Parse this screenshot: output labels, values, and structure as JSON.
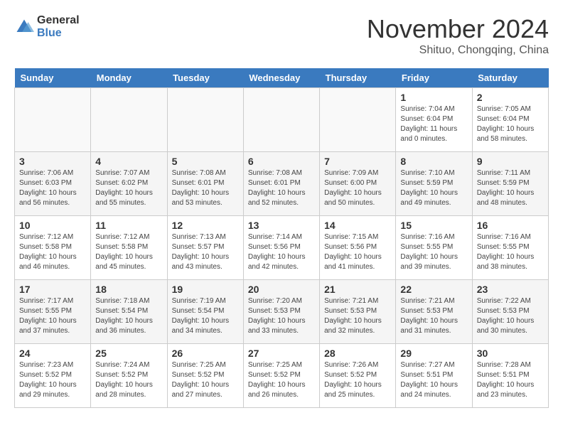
{
  "header": {
    "logo_general": "General",
    "logo_blue": "Blue",
    "month_title": "November 2024",
    "subtitle": "Shituo, Chongqing, China"
  },
  "days_of_week": [
    "Sunday",
    "Monday",
    "Tuesday",
    "Wednesday",
    "Thursday",
    "Friday",
    "Saturday"
  ],
  "weeks": [
    [
      {
        "day": "",
        "empty": true
      },
      {
        "day": "",
        "empty": true
      },
      {
        "day": "",
        "empty": true
      },
      {
        "day": "",
        "empty": true
      },
      {
        "day": "",
        "empty": true
      },
      {
        "day": "1",
        "sunrise": "Sunrise: 7:04 AM",
        "sunset": "Sunset: 6:04 PM",
        "daylight": "Daylight: 11 hours and 0 minutes."
      },
      {
        "day": "2",
        "sunrise": "Sunrise: 7:05 AM",
        "sunset": "Sunset: 6:04 PM",
        "daylight": "Daylight: 10 hours and 58 minutes."
      }
    ],
    [
      {
        "day": "3",
        "sunrise": "Sunrise: 7:06 AM",
        "sunset": "Sunset: 6:03 PM",
        "daylight": "Daylight: 10 hours and 56 minutes."
      },
      {
        "day": "4",
        "sunrise": "Sunrise: 7:07 AM",
        "sunset": "Sunset: 6:02 PM",
        "daylight": "Daylight: 10 hours and 55 minutes."
      },
      {
        "day": "5",
        "sunrise": "Sunrise: 7:08 AM",
        "sunset": "Sunset: 6:01 PM",
        "daylight": "Daylight: 10 hours and 53 minutes."
      },
      {
        "day": "6",
        "sunrise": "Sunrise: 7:08 AM",
        "sunset": "Sunset: 6:01 PM",
        "daylight": "Daylight: 10 hours and 52 minutes."
      },
      {
        "day": "7",
        "sunrise": "Sunrise: 7:09 AM",
        "sunset": "Sunset: 6:00 PM",
        "daylight": "Daylight: 10 hours and 50 minutes."
      },
      {
        "day": "8",
        "sunrise": "Sunrise: 7:10 AM",
        "sunset": "Sunset: 5:59 PM",
        "daylight": "Daylight: 10 hours and 49 minutes."
      },
      {
        "day": "9",
        "sunrise": "Sunrise: 7:11 AM",
        "sunset": "Sunset: 5:59 PM",
        "daylight": "Daylight: 10 hours and 48 minutes."
      }
    ],
    [
      {
        "day": "10",
        "sunrise": "Sunrise: 7:12 AM",
        "sunset": "Sunset: 5:58 PM",
        "daylight": "Daylight: 10 hours and 46 minutes."
      },
      {
        "day": "11",
        "sunrise": "Sunrise: 7:12 AM",
        "sunset": "Sunset: 5:58 PM",
        "daylight": "Daylight: 10 hours and 45 minutes."
      },
      {
        "day": "12",
        "sunrise": "Sunrise: 7:13 AM",
        "sunset": "Sunset: 5:57 PM",
        "daylight": "Daylight: 10 hours and 43 minutes."
      },
      {
        "day": "13",
        "sunrise": "Sunrise: 7:14 AM",
        "sunset": "Sunset: 5:56 PM",
        "daylight": "Daylight: 10 hours and 42 minutes."
      },
      {
        "day": "14",
        "sunrise": "Sunrise: 7:15 AM",
        "sunset": "Sunset: 5:56 PM",
        "daylight": "Daylight: 10 hours and 41 minutes."
      },
      {
        "day": "15",
        "sunrise": "Sunrise: 7:16 AM",
        "sunset": "Sunset: 5:55 PM",
        "daylight": "Daylight: 10 hours and 39 minutes."
      },
      {
        "day": "16",
        "sunrise": "Sunrise: 7:16 AM",
        "sunset": "Sunset: 5:55 PM",
        "daylight": "Daylight: 10 hours and 38 minutes."
      }
    ],
    [
      {
        "day": "17",
        "sunrise": "Sunrise: 7:17 AM",
        "sunset": "Sunset: 5:55 PM",
        "daylight": "Daylight: 10 hours and 37 minutes."
      },
      {
        "day": "18",
        "sunrise": "Sunrise: 7:18 AM",
        "sunset": "Sunset: 5:54 PM",
        "daylight": "Daylight: 10 hours and 36 minutes."
      },
      {
        "day": "19",
        "sunrise": "Sunrise: 7:19 AM",
        "sunset": "Sunset: 5:54 PM",
        "daylight": "Daylight: 10 hours and 34 minutes."
      },
      {
        "day": "20",
        "sunrise": "Sunrise: 7:20 AM",
        "sunset": "Sunset: 5:53 PM",
        "daylight": "Daylight: 10 hours and 33 minutes."
      },
      {
        "day": "21",
        "sunrise": "Sunrise: 7:21 AM",
        "sunset": "Sunset: 5:53 PM",
        "daylight": "Daylight: 10 hours and 32 minutes."
      },
      {
        "day": "22",
        "sunrise": "Sunrise: 7:21 AM",
        "sunset": "Sunset: 5:53 PM",
        "daylight": "Daylight: 10 hours and 31 minutes."
      },
      {
        "day": "23",
        "sunrise": "Sunrise: 7:22 AM",
        "sunset": "Sunset: 5:53 PM",
        "daylight": "Daylight: 10 hours and 30 minutes."
      }
    ],
    [
      {
        "day": "24",
        "sunrise": "Sunrise: 7:23 AM",
        "sunset": "Sunset: 5:52 PM",
        "daylight": "Daylight: 10 hours and 29 minutes."
      },
      {
        "day": "25",
        "sunrise": "Sunrise: 7:24 AM",
        "sunset": "Sunset: 5:52 PM",
        "daylight": "Daylight: 10 hours and 28 minutes."
      },
      {
        "day": "26",
        "sunrise": "Sunrise: 7:25 AM",
        "sunset": "Sunset: 5:52 PM",
        "daylight": "Daylight: 10 hours and 27 minutes."
      },
      {
        "day": "27",
        "sunrise": "Sunrise: 7:25 AM",
        "sunset": "Sunset: 5:52 PM",
        "daylight": "Daylight: 10 hours and 26 minutes."
      },
      {
        "day": "28",
        "sunrise": "Sunrise: 7:26 AM",
        "sunset": "Sunset: 5:52 PM",
        "daylight": "Daylight: 10 hours and 25 minutes."
      },
      {
        "day": "29",
        "sunrise": "Sunrise: 7:27 AM",
        "sunset": "Sunset: 5:51 PM",
        "daylight": "Daylight: 10 hours and 24 minutes."
      },
      {
        "day": "30",
        "sunrise": "Sunrise: 7:28 AM",
        "sunset": "Sunset: 5:51 PM",
        "daylight": "Daylight: 10 hours and 23 minutes."
      }
    ]
  ]
}
